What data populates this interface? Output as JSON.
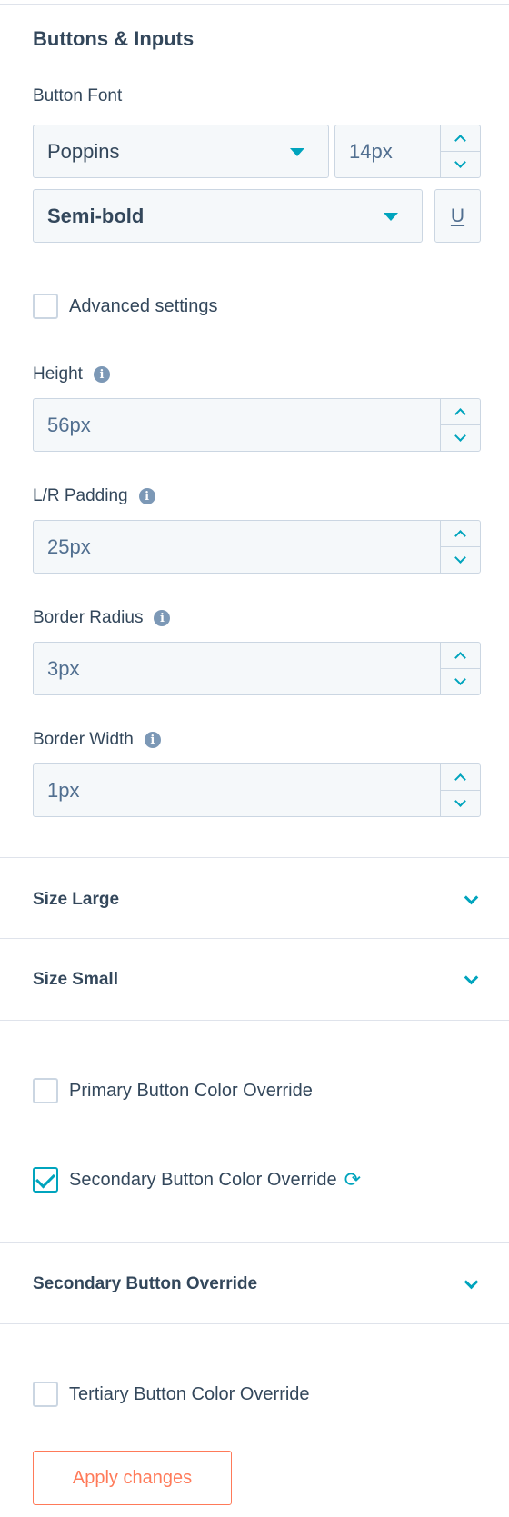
{
  "section": {
    "title": "Buttons & Inputs"
  },
  "button_font": {
    "label": "Button Font",
    "family": "Poppins",
    "size": "14px",
    "weight": "Semi-bold",
    "underline_glyph": "U"
  },
  "advanced": {
    "label": "Advanced settings",
    "checked": false
  },
  "fields": {
    "height": {
      "label": "Height",
      "value": "56px"
    },
    "lr_padding": {
      "label": "L/R Padding",
      "value": "25px"
    },
    "border_radius": {
      "label": "Border Radius",
      "value": "3px"
    },
    "border_width": {
      "label": "Border Width",
      "value": "1px"
    }
  },
  "info_glyph": "i",
  "accordions": {
    "size_large": "Size Large",
    "size_small": "Size Small",
    "secondary_override": "Secondary Button Override"
  },
  "overrides": {
    "primary": {
      "label": "Primary Button Color Override",
      "checked": false
    },
    "secondary": {
      "label": "Secondary Button Color Override",
      "checked": true,
      "refresh_glyph": "⟳"
    },
    "tertiary": {
      "label": "Tertiary Button Color Override",
      "checked": false
    }
  },
  "apply_button": {
    "label": "Apply changes"
  },
  "colors": {
    "accent": "#00a4bd",
    "text": "#33475b",
    "apply": "#ff7a59",
    "field_bg": "#f5f8fa",
    "border": "#cbd6e2"
  },
  "icons": {
    "select_caret": "caret-down-icon",
    "stepper_up": "chevron-up-icon",
    "stepper_down": "chevron-down-icon",
    "info": "info-icon",
    "accordion": "chevron-down-icon",
    "refresh": "refresh-icon",
    "check": "check-icon"
  }
}
